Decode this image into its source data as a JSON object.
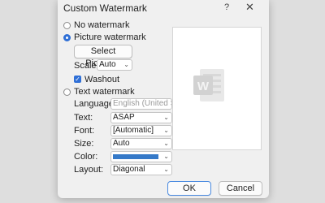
{
  "dialog": {
    "title": "Custom Watermark",
    "help_label": "?",
    "close_label": "✕"
  },
  "options": {
    "no_watermark": "No watermark",
    "picture_watermark": "Picture watermark",
    "text_watermark": "Text watermark",
    "selected": "picture_watermark"
  },
  "picture": {
    "select_button": "Select Picture...",
    "scale_label": "Scale:",
    "scale_value": "Auto",
    "washout_label": "Washout",
    "washout_checked": true
  },
  "text_fields": {
    "language_label": "Language:",
    "language_value": "English (United St",
    "text_label": "Text:",
    "text_value": "ASAP",
    "font_label": "Font:",
    "font_value": "[Automatic]",
    "size_label": "Size:",
    "size_value": "Auto",
    "color_label": "Color:",
    "color_value": "#3579c8",
    "layout_label": "Layout:",
    "layout_value": "Diagonal"
  },
  "preview": {
    "icon": "word-logo-icon",
    "icon_letter": "W"
  },
  "buttons": {
    "ok": "OK",
    "cancel": "Cancel"
  },
  "colors": {
    "accent": "#2f6fd6",
    "dialog_bg": "#f0f0f0"
  }
}
